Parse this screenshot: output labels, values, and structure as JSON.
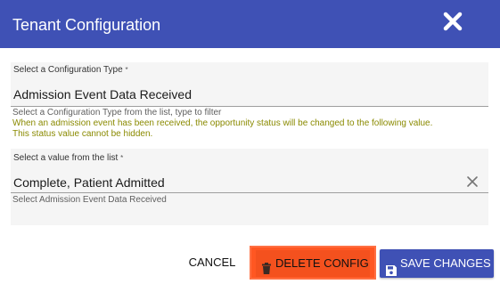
{
  "dialog": {
    "title": "Tenant Configuration",
    "close_icon": "close-icon"
  },
  "colors": {
    "header": "#3f51b5",
    "delete_button": "#f4511e",
    "save_button": "#3f51b5",
    "note_text": "#8a8a00"
  },
  "config_type": {
    "label": "Select a Configuration Type",
    "required_mark": "*",
    "value": "Admission Event Data Received",
    "help": "Select a Configuration Type from the list, type to filter",
    "note_line1": "When an admission event has been received, the opportunity status will be changed to the following value.",
    "note_line2": "This status value cannot be hidden."
  },
  "value_select": {
    "label": "Select a value from the list",
    "required_mark": "*",
    "value": "Complete, Patient Admitted",
    "clear_icon": "clear-icon",
    "help": "Select Admission Event Data Received"
  },
  "actions": {
    "cancel_label": "CANCEL",
    "delete_label": "DELETE CONFIG",
    "delete_icon": "trash-icon",
    "save_label": "SAVE CHANGES",
    "save_icon": "floppy-disk-icon"
  }
}
